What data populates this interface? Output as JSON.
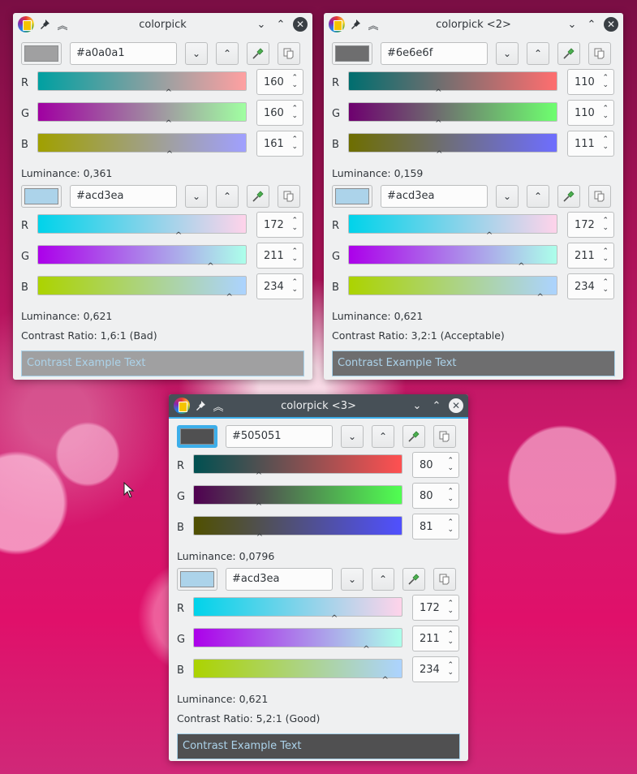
{
  "windows": [
    {
      "title": "colorpick",
      "active": false,
      "colors": [
        {
          "hex": "#a0a0a1",
          "r": 160,
          "g": 160,
          "b": 161,
          "luminance": "Luminance: 0,361"
        },
        {
          "hex": "#acd3ea",
          "r": 172,
          "g": 211,
          "b": 234,
          "luminance": "Luminance: 0,621"
        }
      ],
      "contrast": "Contrast Ratio: 1,6:1 (Bad)",
      "example_text": "Contrast Example Text"
    },
    {
      "title": "colorpick <2>",
      "active": false,
      "colors": [
        {
          "hex": "#6e6e6f",
          "r": 110,
          "g": 110,
          "b": 111,
          "luminance": "Luminance: 0,159"
        },
        {
          "hex": "#acd3ea",
          "r": 172,
          "g": 211,
          "b": 234,
          "luminance": "Luminance: 0,621"
        }
      ],
      "contrast": "Contrast Ratio: 3,2:1 (Acceptable)",
      "example_text": "Contrast Example Text"
    },
    {
      "title": "colorpick <3>",
      "active": true,
      "colors": [
        {
          "hex": "#505051",
          "r": 80,
          "g": 80,
          "b": 81,
          "luminance": "Luminance: 0,0796"
        },
        {
          "hex": "#acd3ea",
          "r": 172,
          "g": 211,
          "b": 234,
          "luminance": "Luminance: 0,621"
        }
      ],
      "contrast": "Contrast Ratio: 5,2:1 (Good)",
      "example_text": "Contrast Example Text"
    }
  ],
  "labels": {
    "r": "R",
    "g": "G",
    "b": "B"
  },
  "icons": {
    "app": "colorpick-app-icon",
    "pin": "pin-icon",
    "keep_above": "double-chevron-up-icon",
    "minimize": "chevron-down-icon",
    "maximize": "chevron-up-icon",
    "close": "close-icon",
    "darker": "chevron-down-icon",
    "lighter": "chevron-up-icon",
    "eyedropper": "eyedropper-icon",
    "copy": "copy-icon"
  },
  "glyphs": {
    "pin": "📌",
    "keep_above": "︽",
    "min": "⌄",
    "max": "⌃",
    "close": "✕",
    "down": "⌄",
    "up": "⌃",
    "copy": "⧉",
    "marker": "^",
    "spin_up": "⌃",
    "spin_down": "⌄"
  },
  "accent": "#3daee9"
}
